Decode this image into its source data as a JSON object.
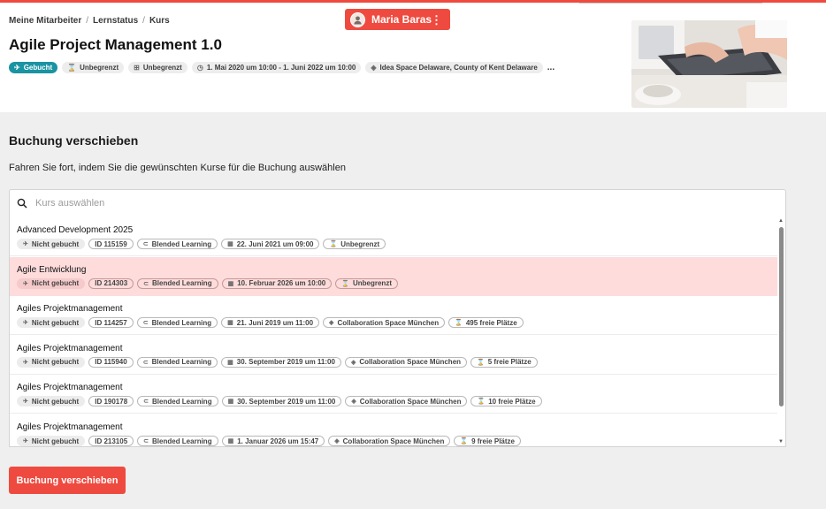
{
  "breadcrumb": [
    "Meine Mitarbeiter",
    "Lernstatus",
    "Kurs"
  ],
  "user": {
    "name": "Maria Baras",
    "menu_icon": "⋮"
  },
  "course": {
    "title": "Agile Project Management 1.0",
    "status": "Gebucht",
    "chips": [
      {
        "icon": "hourglass-icon",
        "glyph": "⌛",
        "label": "Unbegrenzt"
      },
      {
        "icon": "seat-icon",
        "glyph": "⊞",
        "label": "Unbegrenzt"
      },
      {
        "icon": "clock-icon",
        "glyph": "◷",
        "label": "1. Mai 2020 um 10:00 - 1. Juni 2022 um 10:00"
      },
      {
        "icon": "location-icon",
        "glyph": "◈",
        "label": "Idea Space Delaware, County of Kent Delaware"
      }
    ],
    "more": "..."
  },
  "section": {
    "title": "Buchung verschieben",
    "description": "Fahren Sie fort, indem Sie die gewünschten Kurse für die Buchung auswählen"
  },
  "search": {
    "placeholder": "Kurs auswählen",
    "value": ""
  },
  "courses": [
    {
      "name": "Advanced Development 2025",
      "status": "Nicht gebucht",
      "id": "ID 115159",
      "format": "Blended Learning",
      "date": "22. Juni 2021 um 09:00",
      "location": "",
      "capacity": "Unbegrenzt",
      "selected": false
    },
    {
      "name": "Agile Entwicklung",
      "status": "Nicht gebucht",
      "id": "ID 214303",
      "format": "Blended Learning",
      "date": "10. Februar 2026 um 10:00",
      "location": "",
      "capacity": "Unbegrenzt",
      "selected": true
    },
    {
      "name": "Agiles Projektmanagement",
      "status": "Nicht gebucht",
      "id": "ID 114257",
      "format": "Blended Learning",
      "date": "21. Juni 2019 um 11:00",
      "location": "Collaboration Space München",
      "capacity": "495 freie Plätze",
      "selected": false
    },
    {
      "name": "Agiles Projektmanagement",
      "status": "Nicht gebucht",
      "id": "ID 115940",
      "format": "Blended Learning",
      "date": "30. September 2019 um 11:00",
      "location": "Collaboration Space München",
      "capacity": "5 freie Plätze",
      "selected": false
    },
    {
      "name": "Agiles Projektmanagement",
      "status": "Nicht gebucht",
      "id": "ID 190178",
      "format": "Blended Learning",
      "date": "30. September 2019 um 11:00",
      "location": "Collaboration Space München",
      "capacity": "10 freie Plätze",
      "selected": false
    },
    {
      "name": "Agiles Projektmanagement",
      "status": "Nicht gebucht",
      "id": "ID 213105",
      "format": "Blended Learning",
      "date": "1. Januar 2026 um 15:47",
      "location": "Collaboration Space München",
      "capacity": "9 freie Plätze",
      "selected": false
    }
  ],
  "actions": {
    "submit": "Buchung verschieben"
  },
  "colors": {
    "accent": "#ef4a3f",
    "status_booked": "#1a93a3",
    "selected_row": "#fddcdb"
  }
}
